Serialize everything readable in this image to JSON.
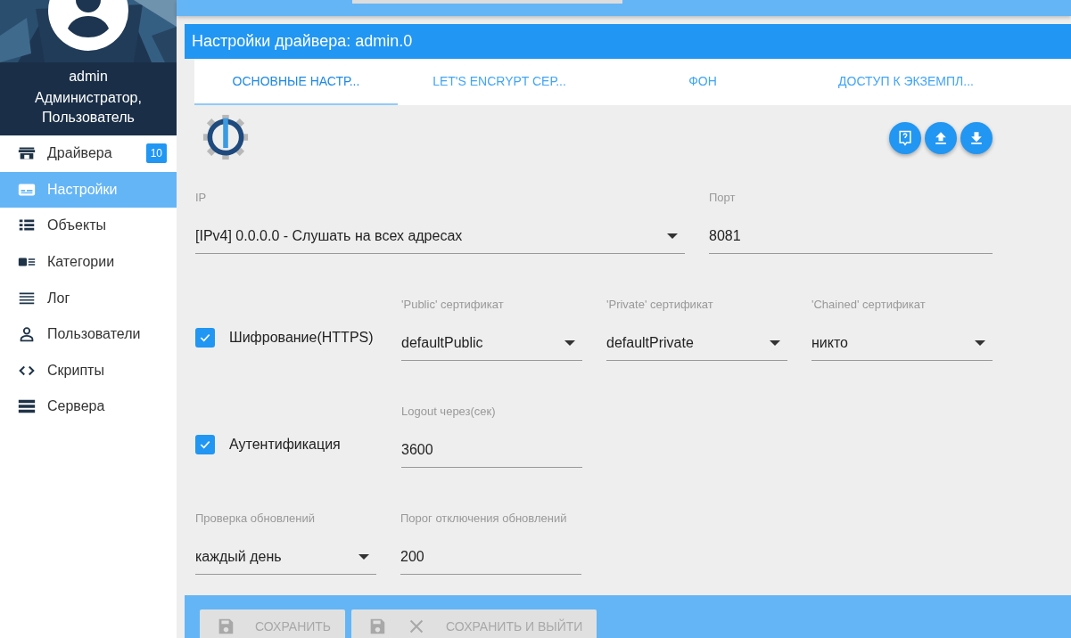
{
  "user": {
    "name": "admin",
    "roles": "Администратор, Пользователь"
  },
  "sidebar": {
    "items": [
      {
        "label": "Драйвера",
        "selected": false,
        "badge": "10"
      },
      {
        "label": "Настройки",
        "selected": true
      },
      {
        "label": "Объекты",
        "selected": false
      },
      {
        "label": "Категории",
        "selected": false
      },
      {
        "label": "Лог",
        "selected": false
      },
      {
        "label": "Пользователи",
        "selected": false
      },
      {
        "label": "Скрипты",
        "selected": false
      },
      {
        "label": "Сервера",
        "selected": false
      }
    ]
  },
  "dialog": {
    "title": "Настройки драйвера: admin.0",
    "tabs": [
      {
        "label": "ОСНОВНЫЕ НАСТР...",
        "selected": true
      },
      {
        "label": "LET'S ENCRYPT СЕР...",
        "selected": false
      },
      {
        "label": "ФОН",
        "selected": false
      },
      {
        "label": "ДОСТУП К ЭКЗЕМПЛ...",
        "selected": false
      }
    ],
    "rows": [
      {
        "fields": [
          {
            "kind": "select",
            "label": "IP",
            "value": "[IPv4] 0.0.0.0 - Слушать на всех адресах"
          },
          {
            "kind": "text",
            "label": "Порт",
            "value": "8081"
          }
        ]
      },
      {
        "fields": [
          {
            "kind": "checkbox",
            "label": "Шифрование(HTTPS)",
            "checked": true
          },
          {
            "kind": "select",
            "label": "'Public' сертификат",
            "value": "defaultPublic"
          },
          {
            "kind": "select",
            "label": "'Private' сертификат",
            "value": "defaultPrivate"
          },
          {
            "kind": "select",
            "label": "'Chained' сертификат",
            "value": "никто"
          }
        ]
      },
      {
        "fields": [
          {
            "kind": "checkbox",
            "label": "Аутентификация",
            "checked": true
          },
          {
            "kind": "text",
            "label": "Logout через(сек)",
            "value": "3600"
          }
        ]
      },
      {
        "fields": [
          {
            "kind": "select",
            "label": "Проверка обновлений",
            "value": "каждый день"
          },
          {
            "kind": "text",
            "label": "Порог отключения обновлений",
            "value": "200"
          }
        ]
      }
    ]
  },
  "buttons": [
    {
      "label": "СОХРАНИТЬ",
      "disabled": true
    },
    {
      "label": "СОХРАНИТЬ И ВЫЙТИ",
      "disabled": true
    }
  ]
}
